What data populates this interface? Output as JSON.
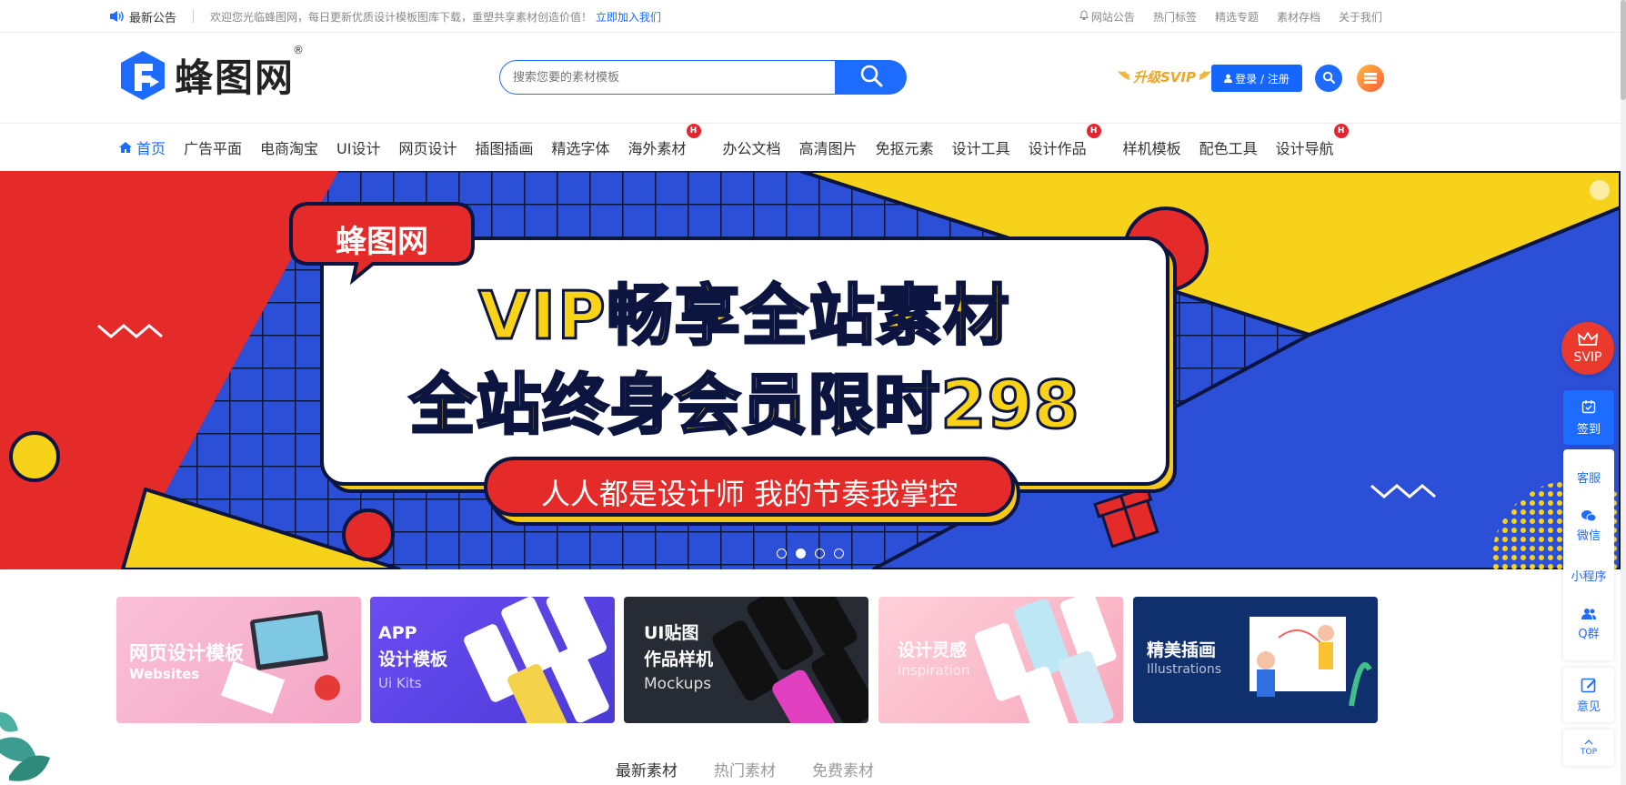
{
  "topbar": {
    "notice_title": "最新公告",
    "welcome": "欢迎您光临蜂图网，每日更新优质设计模板图库下载，重塑共享素材创造价值！",
    "join_link": "立即加入我们",
    "links": [
      "网站公告",
      "热门标签",
      "精选专题",
      "素材存档",
      "关于我们"
    ]
  },
  "header": {
    "logo_text": "蜂图网",
    "logo_reg": "®",
    "search_placeholder": "搜索您要的素材模板",
    "svip_upgrade": "升级SVIP",
    "login_label": "登录 / 注册"
  },
  "nav": {
    "items": [
      {
        "label": "首页",
        "hot": false,
        "active": true
      },
      {
        "label": "广告平面",
        "hot": false
      },
      {
        "label": "电商淘宝",
        "hot": false
      },
      {
        "label": "UI设计",
        "hot": false
      },
      {
        "label": "网页设计",
        "hot": false
      },
      {
        "label": "插图插画",
        "hot": false
      },
      {
        "label": "精选字体",
        "hot": false
      },
      {
        "label": "海外素材",
        "hot": true
      },
      {
        "label": "办公文档",
        "hot": false
      },
      {
        "label": "高清图片",
        "hot": false
      },
      {
        "label": "免抠元素",
        "hot": false
      },
      {
        "label": "设计工具",
        "hot": false
      },
      {
        "label": "设计作品",
        "hot": true
      },
      {
        "label": "样机模板",
        "hot": false
      },
      {
        "label": "配色工具",
        "hot": false
      },
      {
        "label": "设计导航",
        "hot": true
      }
    ],
    "hot_badge": "H"
  },
  "banner": {
    "badge": "蜂图网",
    "line1": "VIP畅享全站素材",
    "line2": "全站终身会员限时298",
    "slogan": "人人都是设计师 我的节奏我掌控",
    "slides": 4,
    "active_slide": 2
  },
  "cards": [
    {
      "title": "网页设计模板",
      "subtitle": "Websites",
      "color": "#f5a9c8"
    },
    {
      "title": "APP\n设计模板",
      "subtitle": "Ui Kits",
      "color": "#6a4bf0"
    },
    {
      "title": "UI贴图\n作品样机",
      "subtitle": "Mockups",
      "color": "#262a33"
    },
    {
      "title": "设计灵感",
      "subtitle": "Inspiration",
      "color": "#f7b8c6"
    },
    {
      "title": "精美插画",
      "subtitle": "Illustrations",
      "color": "#0f2f6d"
    }
  ],
  "tabs": [
    "最新素材",
    "热门素材",
    "免费素材"
  ],
  "float": {
    "svip": "SVIP",
    "signin": "签到",
    "service": "客服",
    "wechat": "微信",
    "miniprogram": "小程序",
    "qgroup": "Q群",
    "feedback": "意见",
    "top": "TOP"
  },
  "colors": {
    "accent": "#1e6bff",
    "hot": "#e8242f",
    "svip": "#f0a622"
  }
}
